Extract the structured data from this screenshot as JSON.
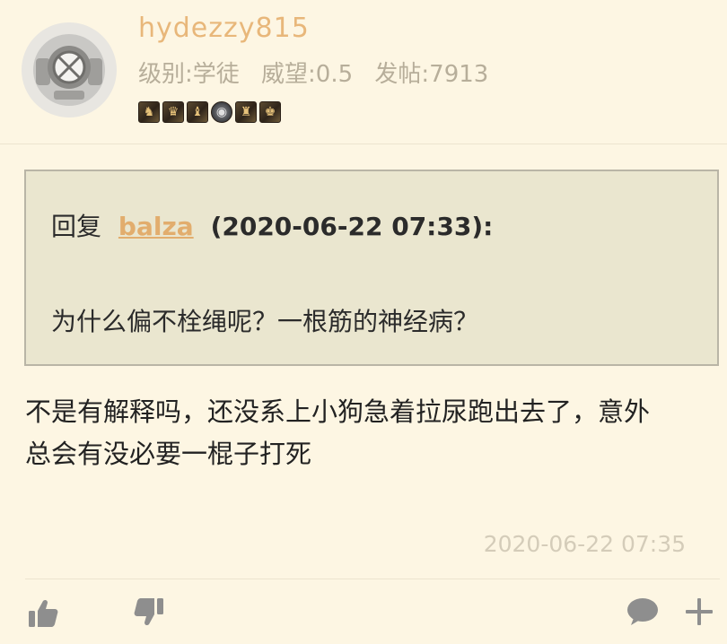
{
  "user": {
    "name": "hydezzy815",
    "level": "级别:学徒",
    "prestige": "威望:0.5",
    "posts": "发帖:7913",
    "avatar_icon": "diving-helmet-icon",
    "badges": [
      "badge-icon",
      "badge-icon",
      "badge-icon",
      "overwatch-badge-icon",
      "badge-icon",
      "badge-icon"
    ]
  },
  "quote": {
    "reply_label": "回复",
    "author": "balza",
    "time": "(2020-06-22 07:33):",
    "text": "为什么偏不栓绳呢？一根筋的神经病？"
  },
  "post": {
    "lines": [
      "不是有解释吗，还没系上小狗急着拉尿跑出去了，意外",
      "总会有没必要一棍子打死"
    ],
    "timestamp": "2020-06-22 07:35"
  },
  "actions": {
    "like_icon": "thumbs-up-icon",
    "dislike_icon": "thumbs-down-icon",
    "comment_icon": "comment-icon",
    "add_icon": "plus-icon"
  },
  "colors": {
    "background": "#fdf6e3",
    "username": "#e8b77a",
    "author_link": "#e2ad6d",
    "quote_bg": "#eae6cf",
    "muted": "#b7ae9a"
  }
}
